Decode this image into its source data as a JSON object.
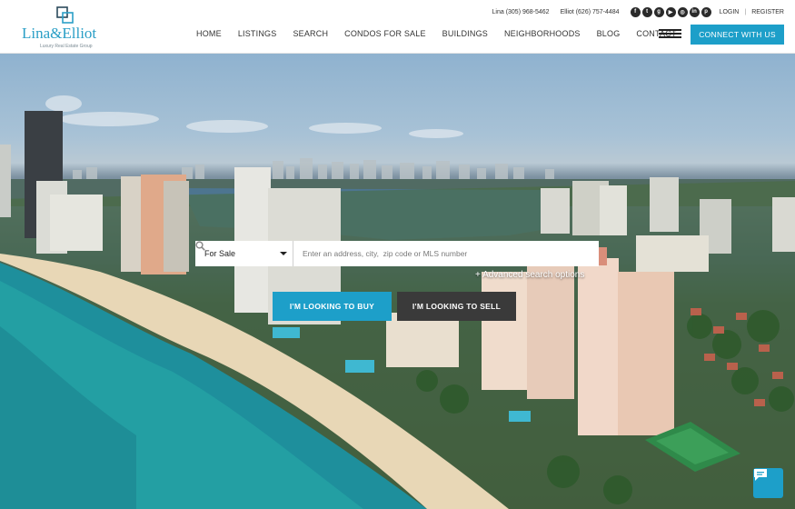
{
  "brand": {
    "name": "Lina&Elliot",
    "tagline": "Luxury Real Estate Group",
    "color": "#2b9fc6"
  },
  "topbar": {
    "phone_lina": "Lina (305) 968-5462",
    "phone_elliot": "Elliot (626) 757-4484",
    "socials": [
      {
        "icon": "facebook-icon",
        "glyph": "f"
      },
      {
        "icon": "twitter-icon",
        "glyph": "t"
      },
      {
        "icon": "google-plus-icon",
        "glyph": "g"
      },
      {
        "icon": "youtube-icon",
        "glyph": "▶"
      },
      {
        "icon": "instagram-icon",
        "glyph": "◎"
      },
      {
        "icon": "linkedin-icon",
        "glyph": "in"
      },
      {
        "icon": "pinterest-icon",
        "glyph": "p"
      }
    ],
    "login": "LOGIN",
    "separator": "|",
    "register": "REGISTER"
  },
  "nav": {
    "items": [
      "HOME",
      "LISTINGS",
      "SEARCH",
      "CONDOS FOR SALE",
      "BUILDINGS",
      "NEIGHBORHOODS",
      "BLOG",
      "CONTACT"
    ],
    "connect_label": "CONNECT WITH US"
  },
  "search": {
    "selected_type": "For Sale",
    "placeholder": "Enter an address, city,  zip code or MLS number",
    "advanced_label": "+ Advanced search options"
  },
  "hero": {
    "buy_label": "I'M LOOKING TO BUY",
    "sell_label": "I'M LOOKING TO SELL"
  },
  "colors": {
    "accent": "#1d9fc9",
    "dark_button": "#3a3a3a"
  }
}
